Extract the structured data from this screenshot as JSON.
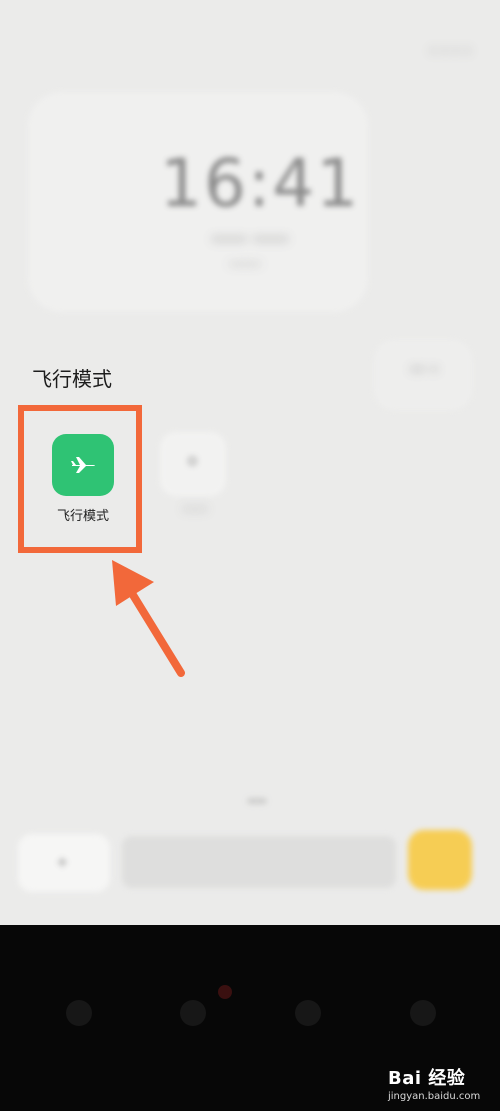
{
  "status": {
    "text": "* * * *"
  },
  "lockscreen": {
    "time": "16:41",
    "date": "**** ****",
    "sub": "*****"
  },
  "right_chip": {
    "text": "** *"
  },
  "quick_settings": {
    "section_label": "飞行模式",
    "airplane_tile": {
      "label": "飞行模式",
      "color": "#2fc374",
      "icon": "airplane-icon"
    },
    "second_tile": {
      "label": "****",
      "icon": "settings-icon"
    }
  },
  "bottom": {
    "left_icon": "+",
    "accent_color": "#f9c83a"
  },
  "annotation": {
    "box_color": "#f2683a",
    "arrow_color": "#f2683a"
  },
  "watermark": {
    "main": "Bai 经验",
    "sub": "jingyan.baidu.com"
  }
}
